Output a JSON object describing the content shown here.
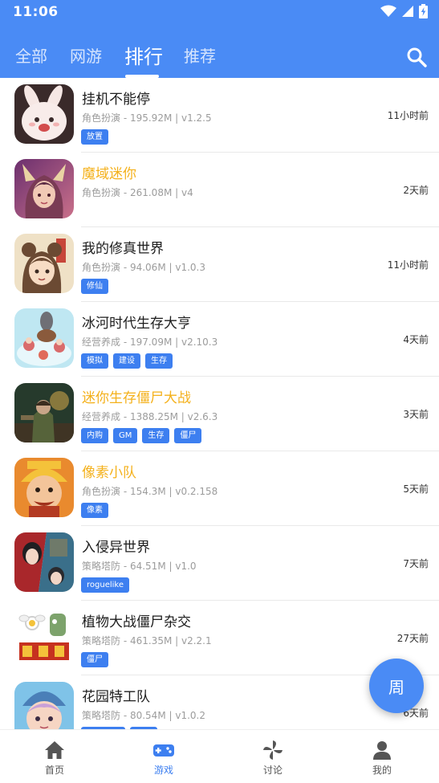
{
  "status_bar": {
    "time": "11:06"
  },
  "tabs": [
    {
      "label": "全部",
      "active": false
    },
    {
      "label": "网游",
      "active": false
    },
    {
      "label": "排行",
      "active": true
    },
    {
      "label": "推荐",
      "active": false
    }
  ],
  "games": [
    {
      "title": "挂机不能停",
      "highlight": false,
      "meta": "角色扮演 - 195.92M | v1.2.5",
      "tags": [
        "放置"
      ],
      "time_ago": "11小时前",
      "icon": "rabbit-game-icon"
    },
    {
      "title": "魔域迷你",
      "highlight": true,
      "meta": "角色扮演 - 261.08M | v4",
      "tags": [],
      "time_ago": "2天前",
      "icon": "fantasy-girl-game-icon"
    },
    {
      "title": "我的修真世界",
      "highlight": false,
      "meta": "角色扮演 - 94.06M | v1.0.3",
      "tags": [
        "修仙"
      ],
      "time_ago": "11小时前",
      "icon": "cultivator-girl-game-icon"
    },
    {
      "title": "冰河时代生存大亨",
      "highlight": false,
      "meta": "经营养成 - 197.09M | v2.10.3",
      "tags": [
        "模拟",
        "建设",
        "生存"
      ],
      "time_ago": "4天前",
      "icon": "ice-age-game-icon"
    },
    {
      "title": "迷你生存僵尸大战",
      "highlight": true,
      "meta": "经营养成 - 1388.25M | v2.6.3",
      "tags": [
        "内购",
        "GM",
        "生存",
        "僵尸"
      ],
      "time_ago": "3天前",
      "icon": "zombie-survival-game-icon"
    },
    {
      "title": "像素小队",
      "highlight": true,
      "meta": "角色扮演 - 154.3M | v0.2.158",
      "tags": [
        "像素"
      ],
      "time_ago": "5天前",
      "icon": "pixel-squad-game-icon"
    },
    {
      "title": "入侵异世界",
      "highlight": false,
      "meta": "策略塔防 - 64.51M | v1.0",
      "tags": [
        "roguelike"
      ],
      "time_ago": "7天前",
      "icon": "invade-world-game-icon"
    },
    {
      "title": "植物大战僵尸杂交",
      "highlight": false,
      "meta": "策略塔防 - 461.35M | v2.2.1",
      "tags": [
        "僵尸"
      ],
      "time_ago": "27天前",
      "icon": "pvz-hybrid-game-icon"
    },
    {
      "title": "花园特工队",
      "highlight": false,
      "meta": "策略塔防 - 80.54M | v1.0.2",
      "tags": [
        "",
        ""
      ],
      "time_ago": "6天前",
      "icon": "garden-squad-game-icon"
    }
  ],
  "fab": {
    "label": "周"
  },
  "bottom_nav": [
    {
      "label": "首页",
      "icon": "home-icon",
      "active": false
    },
    {
      "label": "游戏",
      "icon": "gamepad-icon",
      "active": true
    },
    {
      "label": "讨论",
      "icon": "pinwheel-icon",
      "active": false
    },
    {
      "label": "我的",
      "icon": "user-icon",
      "active": false
    }
  ],
  "colors": {
    "primary": "#4a8bf5",
    "tag": "#3d7ff0",
    "highlight_title": "#f4b11c"
  }
}
